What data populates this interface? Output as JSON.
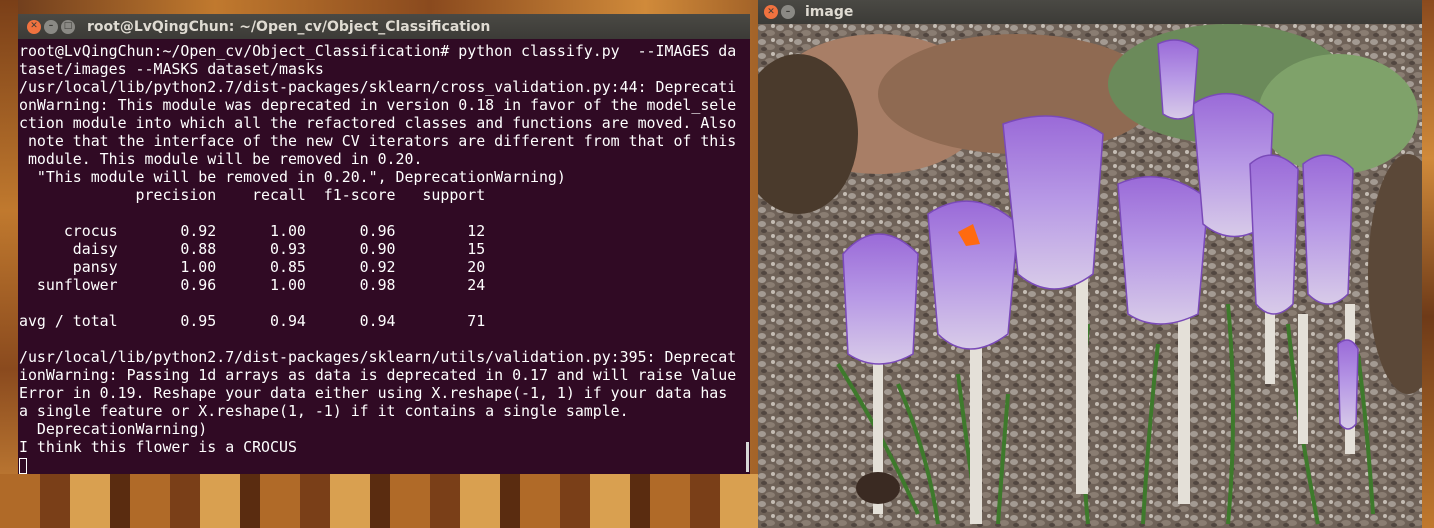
{
  "terminal": {
    "title": "root@LvQingChun: ~/Open_cv/Object_Classification",
    "lines": [
      "root@LvQingChun:~/Open_cv/Object_Classification# python classify.py  --IMAGES da",
      "taset/images --MASKS dataset/masks",
      "/usr/local/lib/python2.7/dist-packages/sklearn/cross_validation.py:44: Deprecati",
      "onWarning: This module was deprecated in version 0.18 in favor of the model_sele",
      "ction module into which all the refactored classes and functions are moved. Also",
      " note that the interface of the new CV iterators are different from that of this",
      " module. This module will be removed in 0.20.",
      "  \"This module will be removed in 0.20.\", DeprecationWarning)",
      "             precision    recall  f1-score   support",
      "",
      "     crocus       0.92      1.00      0.96        12",
      "      daisy       0.88      0.93      0.90        15",
      "      pansy       1.00      0.85      0.92        20",
      "  sunflower       0.96      1.00      0.98        24",
      "",
      "avg / total       0.95      0.94      0.94        71",
      "",
      "/usr/local/lib/python2.7/dist-packages/sklearn/utils/validation.py:395: Deprecat",
      "ionWarning: Passing 1d arrays as data is deprecated in 0.17 and will raise Value",
      "Error in 0.19. Reshape your data either using X.reshape(-1, 1) if your data has",
      "a single feature or X.reshape(1, -1) if it contains a single sample.",
      "  DeprecationWarning)",
      "I think this flower is a CROCUS"
    ]
  },
  "image_window": {
    "title": "image"
  },
  "colors": {
    "terminal_bg": "#300a24",
    "titlebar": "#3c3b37",
    "close_button": "#f0723f"
  },
  "icons": [
    "close-icon",
    "minimize-icon",
    "maximize-icon"
  ]
}
